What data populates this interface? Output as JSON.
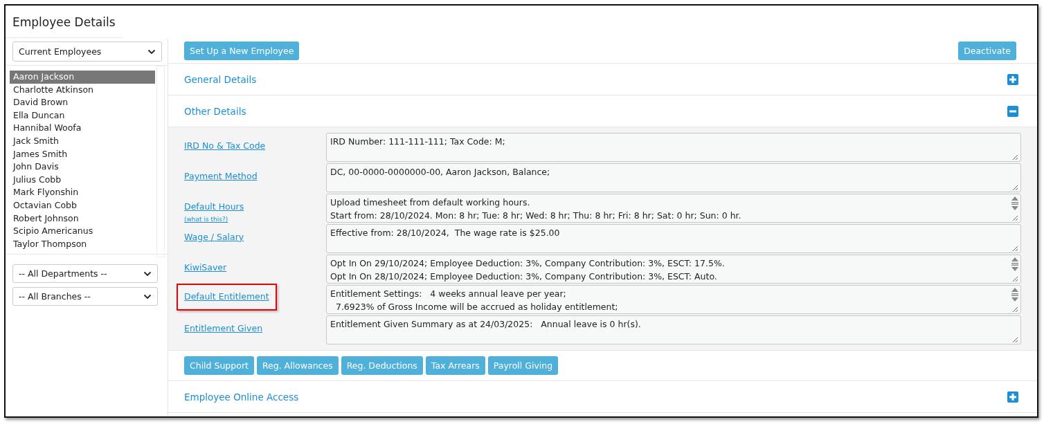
{
  "window": {
    "title": "Employee Details"
  },
  "sidebar": {
    "filter": "Current Employees",
    "employees": [
      {
        "name": "Aaron Jackson",
        "selected": true
      },
      {
        "name": "Charlotte Atkinson",
        "selected": false
      },
      {
        "name": "David Brown",
        "selected": false
      },
      {
        "name": "Ella Duncan",
        "selected": false
      },
      {
        "name": "Hannibal Woofa",
        "selected": false
      },
      {
        "name": "Jack Smith",
        "selected": false
      },
      {
        "name": "James Smith",
        "selected": false
      },
      {
        "name": "John Davis",
        "selected": false
      },
      {
        "name": "Julius Cobb",
        "selected": false
      },
      {
        "name": "Mark Flyonshin",
        "selected": false
      },
      {
        "name": "Octavian Cobb",
        "selected": false
      },
      {
        "name": "Robert Johnson",
        "selected": false
      },
      {
        "name": "Scipio Americanus",
        "selected": false
      },
      {
        "name": "Taylor Thompson",
        "selected": false
      }
    ],
    "department": "-- All Departments --",
    "branch": "-- All Branches --"
  },
  "toolbar": {
    "new_button": "Set Up a New Employee",
    "deactivate_button": "Deactivate"
  },
  "sections": [
    {
      "title": "General Details",
      "expanded": false
    },
    {
      "title": "Other Details",
      "expanded": true,
      "fields": [
        {
          "label": "IRD No & Tax Code",
          "lines": [
            "IRD Number: 111-111-111; Tax Code: M;"
          ],
          "scrollable": false,
          "highlighted": false
        },
        {
          "label": "Payment Method",
          "lines": [
            "DC, 00-0000-0000000-00, Aaron Jackson, Balance;"
          ],
          "scrollable": false,
          "highlighted": false
        },
        {
          "label": "Default Hours",
          "help": "(what is this?)",
          "lines": [
            "Upload timesheet from default working hours.",
            "Start from: 28/10/2024. Mon: 8 hr; Tue: 8 hr; Wed: 8 hr; Thu: 8 hr; Fri: 8 hr; Sat: 0 hr; Sun: 0 hr."
          ],
          "scrollable": true,
          "highlighted": false
        },
        {
          "label": "Wage / Salary",
          "lines": [
            "Effective from: 28/10/2024,  The wage rate is $25.00"
          ],
          "scrollable": false,
          "highlighted": false
        },
        {
          "label": "KiwiSaver",
          "lines": [
            "Opt In On 29/10/2024; Employee Deduction: 3%, Company Contribution: 3%, ESCT: 17.5%.",
            "Opt In On 28/10/2024; Employee Deduction: 3%, Company Contribution: 3%, ESCT: Auto."
          ],
          "scrollable": true,
          "highlighted": false
        },
        {
          "label": "Default Entitlement",
          "lines": [
            "Entitlement Settings:   4 weeks annual leave per year;",
            "  7.6923% of Gross Income will be accrued as holiday entitlement;"
          ],
          "scrollable": true,
          "highlighted": true
        },
        {
          "label": "Entitlement Given",
          "lines": [
            "Entitlement Given Summary as at 24/03/2025:   Annual leave is 0 hr(s)."
          ],
          "scrollable": false,
          "highlighted": false
        }
      ],
      "buttons": [
        "Child Support",
        "Reg. Allowances",
        "Reg. Deductions",
        "Tax Arrears",
        "Payroll Giving"
      ]
    },
    {
      "title": "Employee Online Access",
      "expanded": false
    }
  ]
}
